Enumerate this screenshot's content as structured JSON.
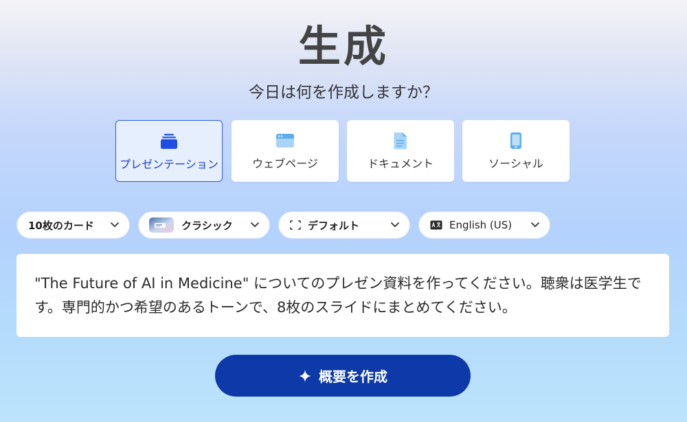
{
  "header": {
    "title": "生成",
    "subtitle": "今日は何を作成しますか？"
  },
  "content_types": [
    {
      "label": "プレゼンテーション",
      "icon": "presentation-icon",
      "selected": true
    },
    {
      "label": "ウェブページ",
      "icon": "webpage-icon",
      "selected": false
    },
    {
      "label": "ドキュメント",
      "icon": "document-icon",
      "selected": false
    },
    {
      "label": "ソーシャル",
      "icon": "mobile-icon",
      "selected": false
    }
  ],
  "options": {
    "cards": {
      "label": "10枚のカード",
      "icon": "chevron-down-icon"
    },
    "theme": {
      "label": "クラシック",
      "icon": "theme-thumbnail-icon"
    },
    "layout": {
      "label": "デフォルト",
      "icon": "aspect-ratio-icon"
    },
    "language": {
      "label": "English (US)",
      "icon": "language-icon"
    }
  },
  "prompt": {
    "text": "\"The Future of AI in Medicine\" についてのプレゼン資料を作ってください。聴衆は医学生です。専門的かつ希望のあるトーンで、8枚のスライドにまとめてください。"
  },
  "generate_button": {
    "label": "概要を作成",
    "icon": "sparkle-icon"
  },
  "colors": {
    "accent": "#2f5fe8",
    "button": "#0d3aa8",
    "title": "#444444"
  }
}
